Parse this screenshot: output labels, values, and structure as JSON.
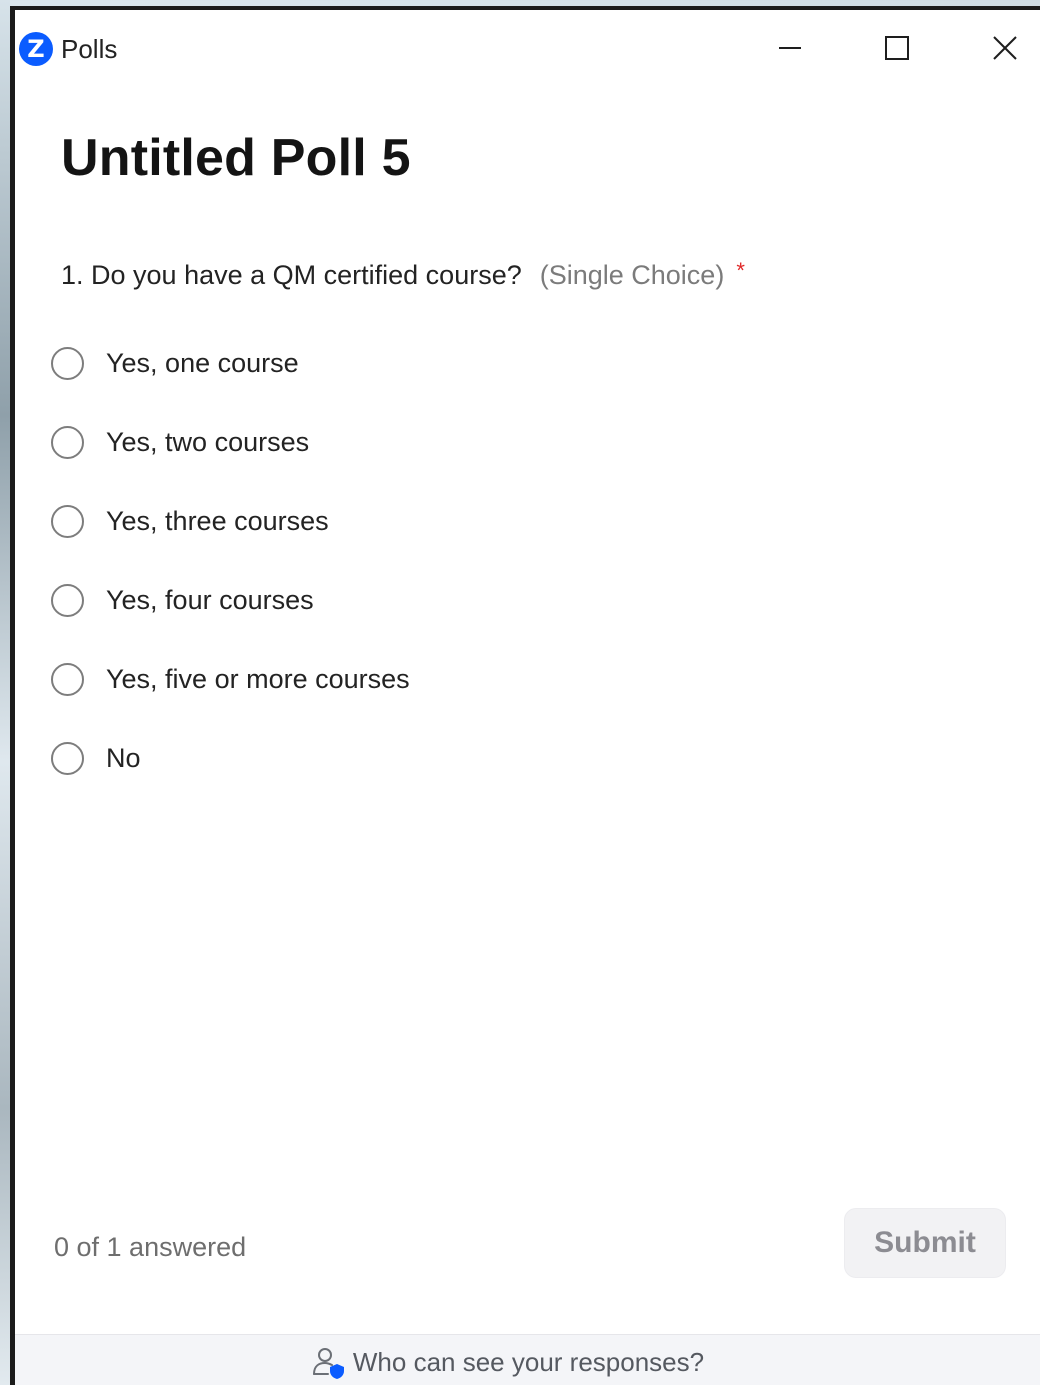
{
  "window": {
    "title": "Polls",
    "logo_letter": "Z"
  },
  "poll": {
    "title": "Untitled Poll 5",
    "question": {
      "text": "1. Do you have a QM certified course?",
      "type": "(Single Choice)",
      "required_mark": "*"
    },
    "options": [
      "Yes, one course",
      "Yes, two courses",
      "Yes, three courses",
      "Yes, four courses",
      "Yes, five or more courses",
      "No"
    ]
  },
  "status": {
    "answered": "0 of 1 answered"
  },
  "actions": {
    "submit_label": "Submit"
  },
  "footer": {
    "privacy_link": "Who can see your responses?"
  },
  "icons": {
    "logo": "zoom-logo-icon",
    "minimize": "minimize-icon",
    "maximize": "maximize-icon",
    "close": "close-icon",
    "privacy": "user-shield-icon"
  },
  "colors": {
    "brand": "#0b5cff",
    "required": "#e02828"
  }
}
